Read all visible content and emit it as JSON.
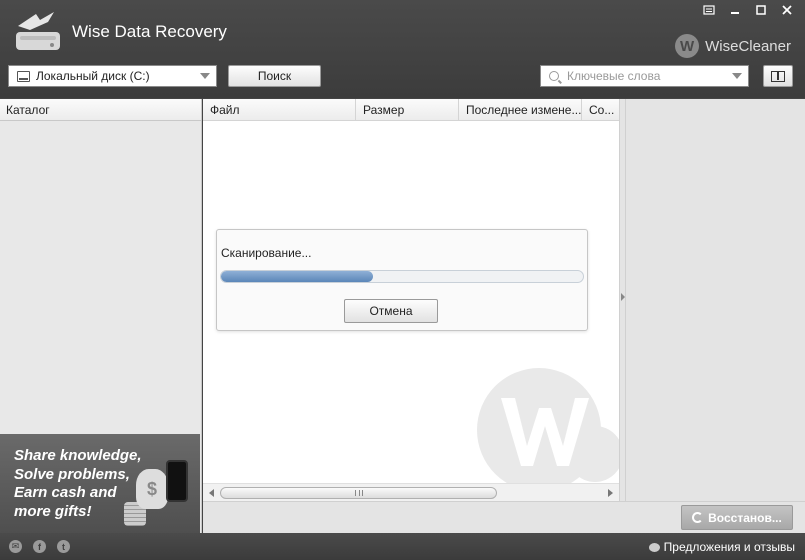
{
  "app": {
    "title": "Wise Data Recovery",
    "brand": "WiseCleaner",
    "brand_mark": "W"
  },
  "toolbar": {
    "drive_selected": "Локальный диск (C:)",
    "search_label": "Поиск",
    "keyword_placeholder": "Ключевые слова"
  },
  "catalog": {
    "header": "Каталог"
  },
  "files": {
    "columns": [
      "Файл",
      "Размер",
      "Последнее измене...",
      "Со..."
    ]
  },
  "ad": {
    "lines": [
      "Share knowledge,",
      "Solve problems,",
      "Earn cash and",
      "more gifts!"
    ],
    "bag_symbol": "$"
  },
  "scan": {
    "label": "Сканирование...",
    "progress": 0.42,
    "cancel_label": "Отмена"
  },
  "actions": {
    "restore_label": "Восстанов..."
  },
  "status": {
    "feedback_label": "Предложения и отзывы",
    "social": [
      "email-icon",
      "facebook-icon",
      "twitter-icon"
    ]
  },
  "colors": {
    "accent": "#5b86b8",
    "chrome": "#444444"
  }
}
